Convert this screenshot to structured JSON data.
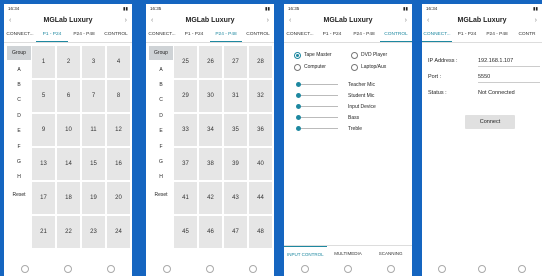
{
  "app_title": "MGLab Luxury",
  "status_times": [
    "16:34",
    "16:35",
    "16:35",
    "16:34"
  ],
  "tabs": [
    "CONNECT...",
    "P1 - P24",
    "P24 - P48",
    "CONTROL"
  ],
  "tabs_p4": [
    "CONNECT...",
    "P1 - P24",
    "P24 - P48",
    "CONTR"
  ],
  "group": {
    "header": "Group",
    "items": [
      "A",
      "B",
      "C",
      "D",
      "E",
      "F",
      "G",
      "H"
    ],
    "reset": "Reset"
  },
  "grid1": [
    "1",
    "2",
    "3",
    "4",
    "5",
    "6",
    "7",
    "8",
    "9",
    "10",
    "11",
    "12",
    "13",
    "14",
    "15",
    "16",
    "17",
    "18",
    "19",
    "20",
    "21",
    "22",
    "23",
    "24"
  ],
  "grid2": [
    "25",
    "26",
    "27",
    "28",
    "29",
    "30",
    "31",
    "32",
    "33",
    "34",
    "35",
    "36",
    "37",
    "38",
    "39",
    "40",
    "41",
    "42",
    "43",
    "44",
    "45",
    "46",
    "47",
    "48"
  ],
  "control": {
    "radios": [
      {
        "label": "Tape Master",
        "selected": true
      },
      {
        "label": "DVD Player",
        "selected": false
      },
      {
        "label": "Computer",
        "selected": false
      },
      {
        "label": "Laptop/Aux",
        "selected": false
      }
    ],
    "sliders": [
      "Teacher Mic",
      "Student Mic",
      "Input Device",
      "Bass",
      "Treble"
    ],
    "bottom_tabs": [
      "INPUT CONTROL",
      "MULTIMEDIA",
      "SCANNING"
    ]
  },
  "connect": {
    "ip_label": "IP Address :",
    "ip_value": "192.168.1.107",
    "port_label": "Port :",
    "port_value": "5550",
    "status_label": "Status :",
    "status_value": "Not Connected",
    "connect_button": "Connect"
  },
  "colors": {
    "background": "#1565c0",
    "accent": "#1e88a0"
  }
}
